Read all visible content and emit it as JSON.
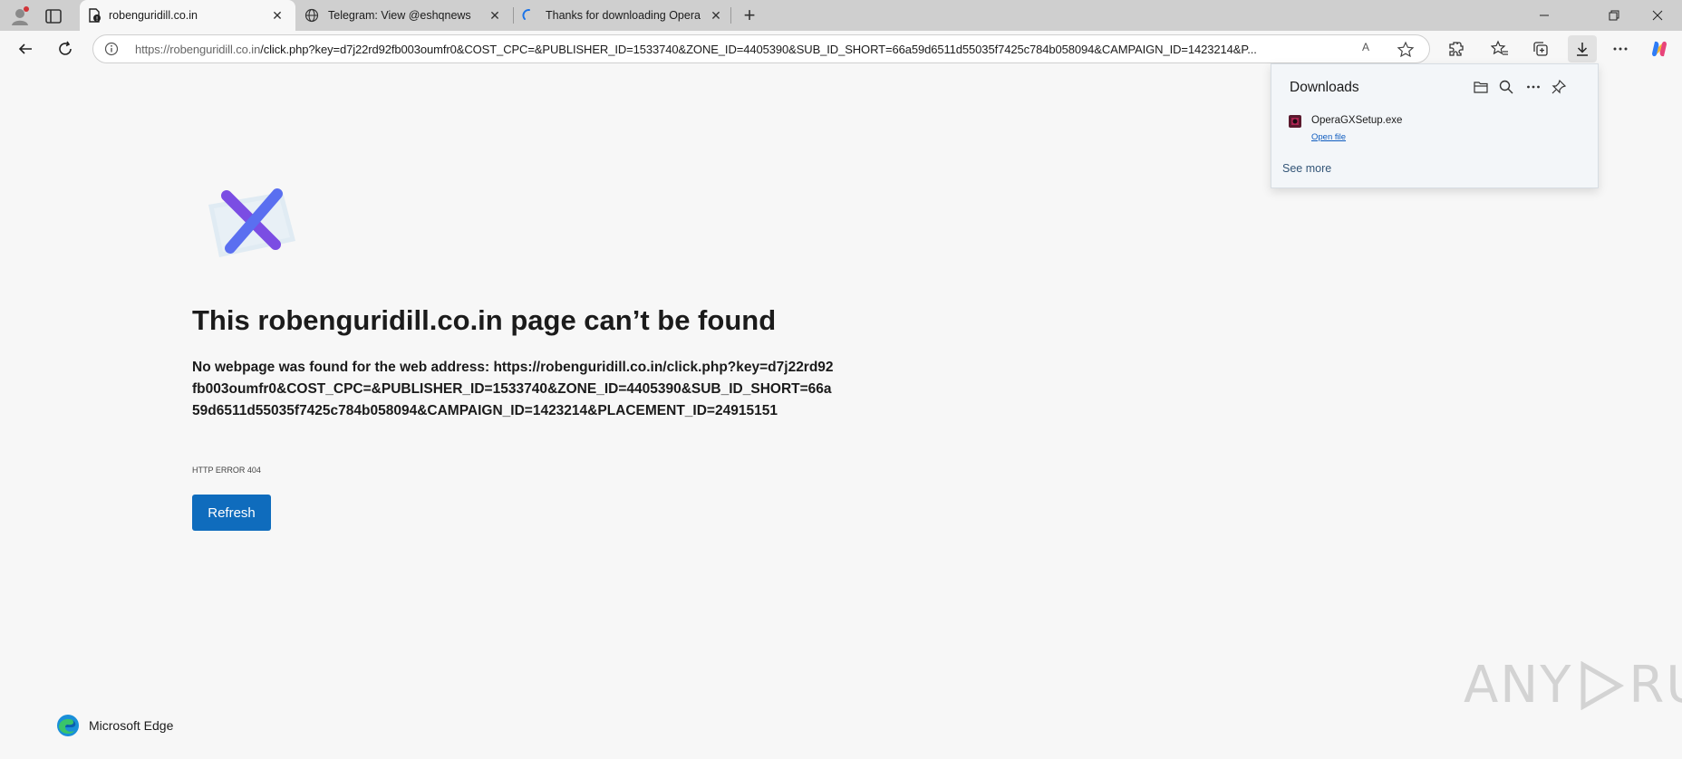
{
  "tabs": [
    {
      "title": "robenguridill.co.in",
      "active": true,
      "favicon": "warning-page-icon"
    },
    {
      "title": "Telegram: View @eshqnews",
      "active": false,
      "favicon": "globe-icon"
    },
    {
      "title": "Thanks for downloading Opera",
      "active": false,
      "favicon": "loading-spinner-icon"
    }
  ],
  "toolbar": {
    "url_host": "https://robenguridill.co.in",
    "url_rest": "/click.php?key=d7j22rd92fb003oumfr0&COST_CPC=&PUBLISHER_ID=1533740&ZONE_ID=4405390&SUB_ID_SHORT=66a59d6511d55035f7425c784b058094&CAMPAIGN_ID=1423214&P...",
    "read_aloud": "A"
  },
  "error": {
    "title": "This robenguridill.co.in page can’t be found",
    "description_lead": "No webpage was found for the web address:",
    "address": "https://robenguridill.co.in/click.php?key=d7j22rd92fb003oumfr0&COST_CPC=&PUBLISHER_ID=1533740&ZONE_ID=4405390&SUB_ID_SHORT=66a59d6511d55035f7425c784b058094&CAMPAIGN_ID=1423214&PLACEMENT_ID=24915151",
    "code": "HTTP ERROR 404",
    "refresh_label": "Refresh"
  },
  "brand": {
    "name": "Microsoft Edge"
  },
  "watermark": {
    "left": "ANY",
    "right": "RUN"
  },
  "downloads": {
    "title": "Downloads",
    "items": [
      {
        "filename": "OperaGXSetup.exe",
        "action": "Open file"
      }
    ],
    "see_more": "See more"
  },
  "colors": {
    "accent": "#0f6cbd",
    "page_bg": "#f7f7f7",
    "tabstrip_bg": "#cfcfcf"
  }
}
